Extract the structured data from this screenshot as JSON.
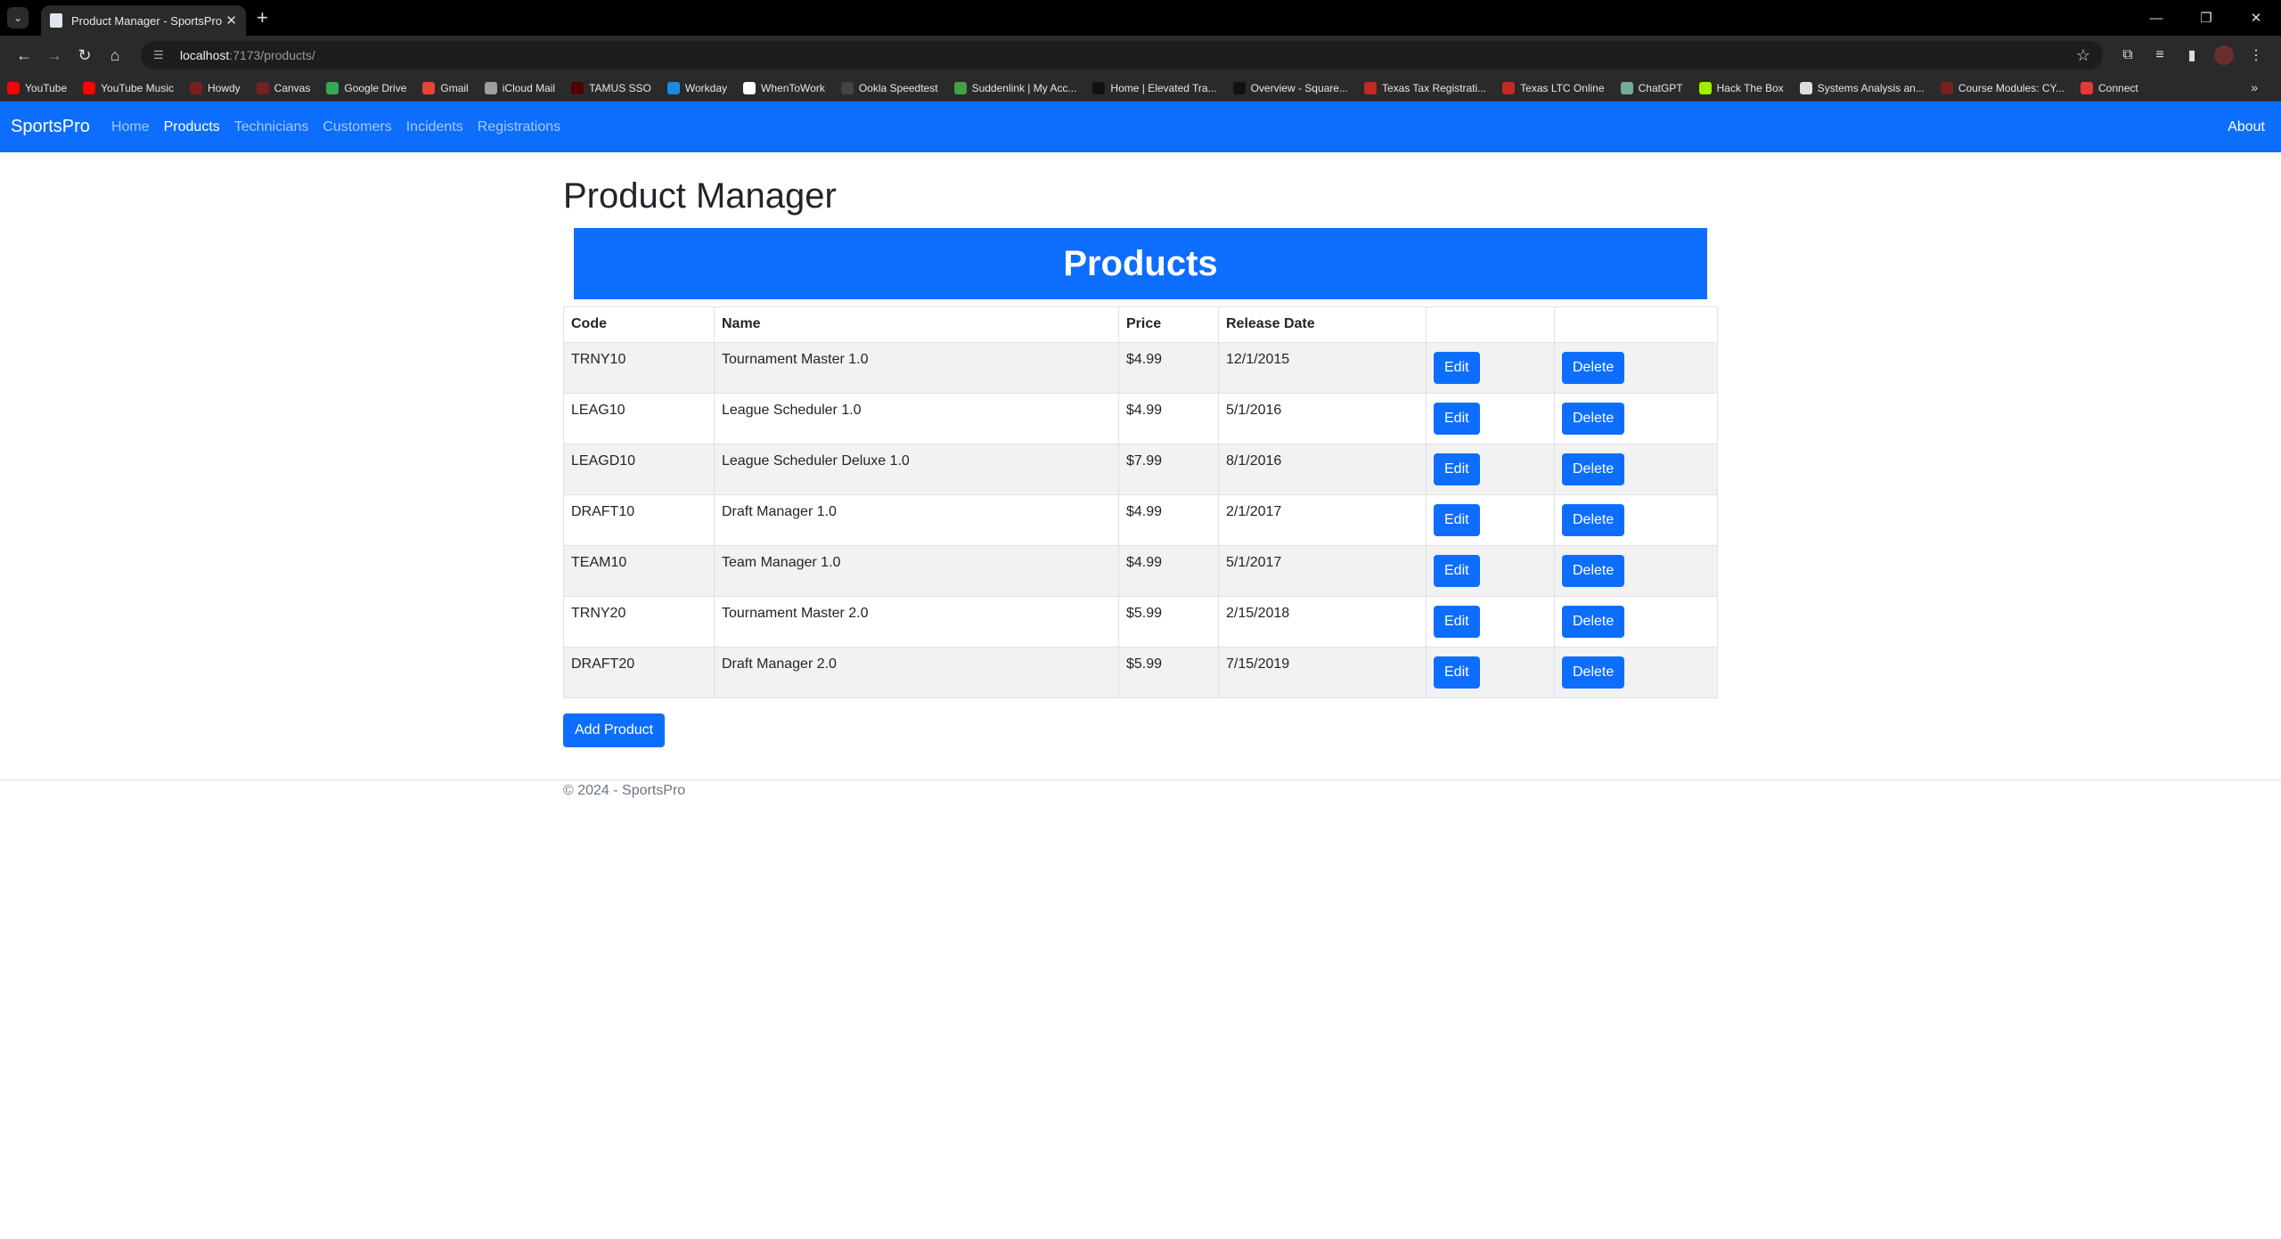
{
  "browser": {
    "tab_title": "Product Manager - SportsPro",
    "url_host": "localhost",
    "url_path": ":7173/products/",
    "bookmarks": [
      {
        "label": "YouTube",
        "color": "#ff0000"
      },
      {
        "label": "YouTube Music",
        "color": "#ff0000"
      },
      {
        "label": "Howdy",
        "color": "#7a1f1f"
      },
      {
        "label": "Canvas",
        "color": "#7a1f1f"
      },
      {
        "label": "Google Drive",
        "color": "#34a853"
      },
      {
        "label": "Gmail",
        "color": "#ea4335"
      },
      {
        "label": "iCloud Mail",
        "color": "#9e9e9e"
      },
      {
        "label": "TAMUS SSO",
        "color": "#500000"
      },
      {
        "label": "Workday",
        "color": "#1e88e5"
      },
      {
        "label": "WhenToWork",
        "color": "#ffffff"
      },
      {
        "label": "Ookla Speedtest",
        "color": "#444444"
      },
      {
        "label": "Suddenlink | My Acc...",
        "color": "#43a047"
      },
      {
        "label": "Home | Elevated Tra...",
        "color": "#111111"
      },
      {
        "label": "Overview - Square...",
        "color": "#111111"
      },
      {
        "label": "Texas Tax Registrati...",
        "color": "#c62828"
      },
      {
        "label": "Texas LTC Online",
        "color": "#c62828"
      },
      {
        "label": "ChatGPT",
        "color": "#74aa9c"
      },
      {
        "label": "Hack The Box",
        "color": "#9fef00"
      },
      {
        "label": "Systems Analysis an...",
        "color": "#dddddd"
      },
      {
        "label": "Course Modules: CY...",
        "color": "#7a1f1f"
      },
      {
        "label": "Connect",
        "color": "#e53935"
      }
    ]
  },
  "nav": {
    "brand": "SportsPro",
    "links": [
      "Home",
      "Products",
      "Technicians",
      "Customers",
      "Incidents",
      "Registrations"
    ],
    "active_index": 1,
    "about": "About"
  },
  "page": {
    "title": "Product Manager",
    "banner": "Products",
    "columns": [
      "Code",
      "Name",
      "Price",
      "Release Date",
      "",
      ""
    ],
    "rows": [
      {
        "code": "TRNY10",
        "name": "Tournament Master 1.0",
        "price": "$4.99",
        "date": "12/1/2015"
      },
      {
        "code": "LEAG10",
        "name": "League Scheduler 1.0",
        "price": "$4.99",
        "date": "5/1/2016"
      },
      {
        "code": "LEAGD10",
        "name": "League Scheduler Deluxe 1.0",
        "price": "$7.99",
        "date": "8/1/2016"
      },
      {
        "code": "DRAFT10",
        "name": "Draft Manager 1.0",
        "price": "$4.99",
        "date": "2/1/2017"
      },
      {
        "code": "TEAM10",
        "name": "Team Manager 1.0",
        "price": "$4.99",
        "date": "5/1/2017"
      },
      {
        "code": "TRNY20",
        "name": "Tournament Master 2.0",
        "price": "$5.99",
        "date": "2/15/2018"
      },
      {
        "code": "DRAFT20",
        "name": "Draft Manager 2.0",
        "price": "$5.99",
        "date": "7/15/2019"
      }
    ],
    "edit_label": "Edit",
    "delete_label": "Delete",
    "add_label": "Add Product",
    "footer": "© 2024 - SportsPro"
  },
  "colors": {
    "primary": "#0d6efd",
    "stripe": "#f2f2f2"
  }
}
